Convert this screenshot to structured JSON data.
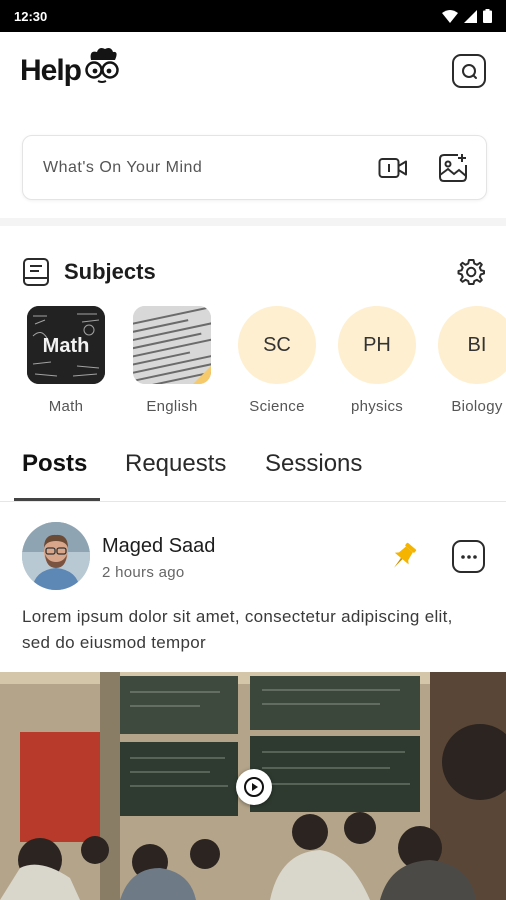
{
  "status_bar": {
    "time": "12:30"
  },
  "app": {
    "logo_text": "Help"
  },
  "composer": {
    "placeholder": "What's On Your Mind"
  },
  "subjects": {
    "title": "Subjects",
    "items": [
      {
        "label": "Math",
        "image_text": "Math"
      },
      {
        "label": "English"
      },
      {
        "label": "Science",
        "initials": "SC"
      },
      {
        "label": "physics",
        "initials": "PH"
      },
      {
        "label": "Biology",
        "initials": "BI"
      }
    ]
  },
  "tabs": [
    {
      "label": "Posts",
      "active": true
    },
    {
      "label": "Requests",
      "active": false
    },
    {
      "label": "Sessions",
      "active": false
    }
  ],
  "post": {
    "author": "Maged Saad",
    "time": "2 hours ago",
    "body": "Lorem ipsum dolor sit amet, consectetur adipiscing elit, sed do eiusmod tempor",
    "pinned": true
  },
  "colors": {
    "accent": "#f5b400",
    "subject_bg": "#fdefcf",
    "status_bar": "#000000"
  },
  "icons": {
    "header": "scan-icon",
    "composer": [
      "video-camera-icon",
      "add-image-icon"
    ],
    "subjects": [
      "book-icon",
      "gear-icon"
    ],
    "post": [
      "pin-icon",
      "more-icon",
      "play-icon"
    ]
  }
}
